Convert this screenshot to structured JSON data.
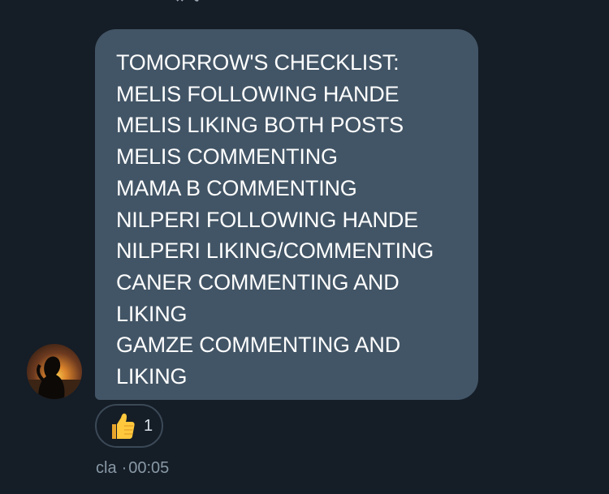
{
  "conversation": {
    "top_icon": "close-icon-partial"
  },
  "message": {
    "sender_avatar": "avatar-silhouette-sunset",
    "lines": [
      "TOMORROW'S CHECKLIST:",
      "MELIS FOLLOWING HANDE",
      "MELIS LIKING BOTH POSTS",
      "MELIS COMMENTING",
      "MAMA B COMMENTING",
      "NILPERI FOLLOWING HANDE",
      "NILPERI LIKING/COMMENTING",
      "CANER COMMENTING AND",
      "LIKING",
      "GAMZE COMMENTING AND",
      "LIKING"
    ],
    "reaction": {
      "icon": "thumbs-up-icon",
      "count": "1"
    },
    "sender": "cla",
    "separator": "·",
    "time": "00:05"
  },
  "colors": {
    "background": "#151d27",
    "bubble": "#425566",
    "meta_text": "#8899a6"
  }
}
